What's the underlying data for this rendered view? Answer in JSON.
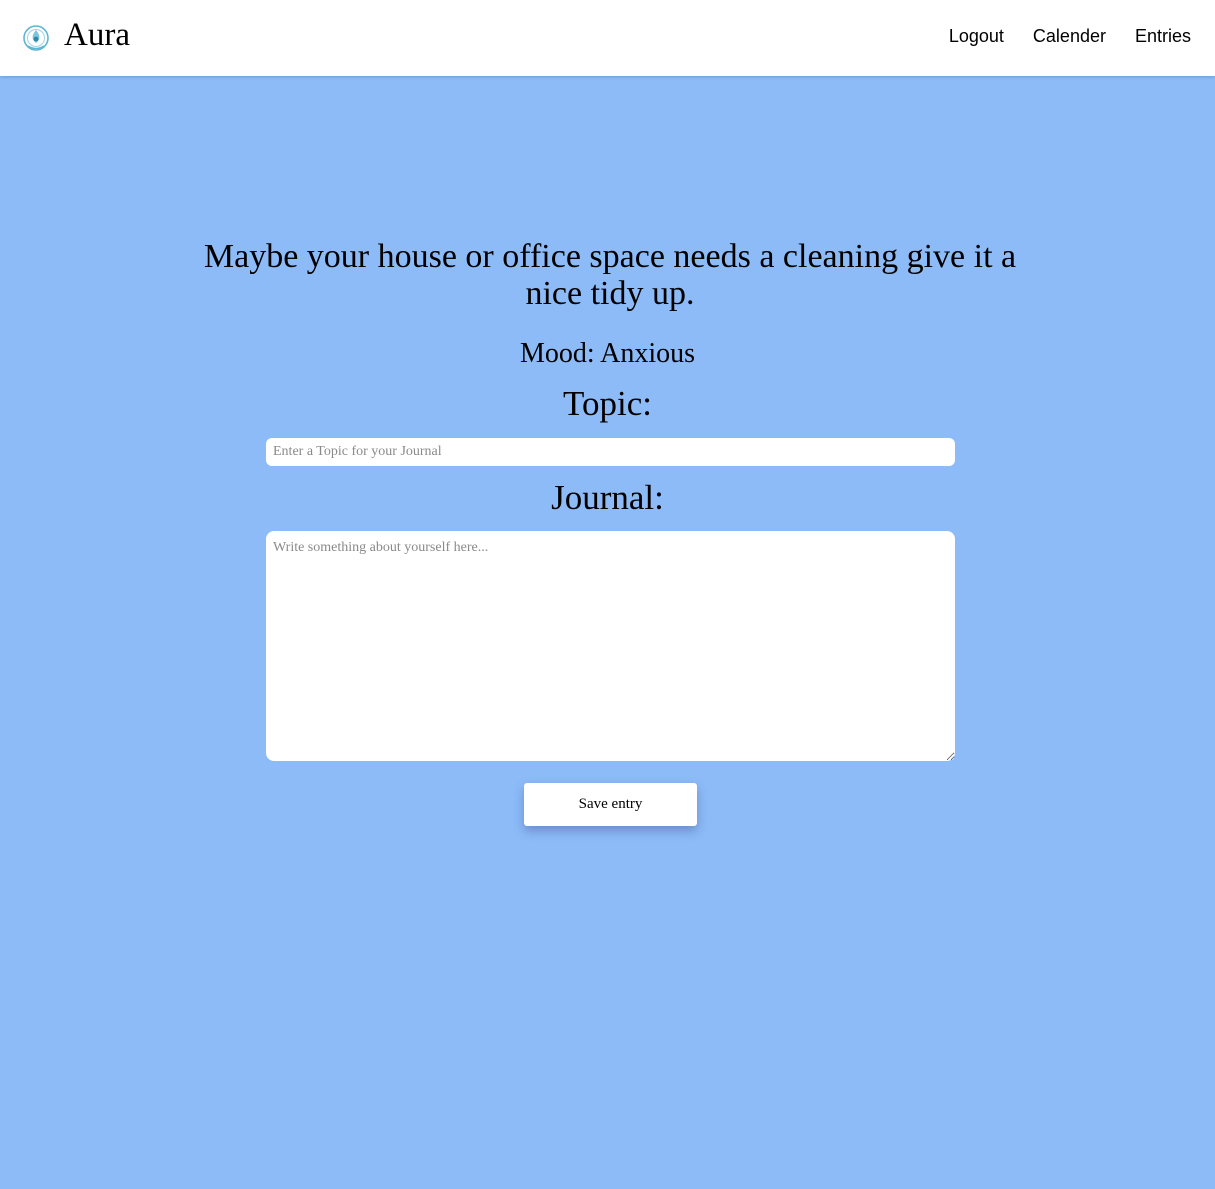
{
  "app": {
    "name": "Aura",
    "logo_icon": "aura-logo-icon",
    "accent": "#4aa8c9"
  },
  "nav": {
    "items": [
      {
        "label": "Logout"
      },
      {
        "label": "Calender"
      },
      {
        "label": "Entries"
      }
    ]
  },
  "main": {
    "prompt": "Maybe your house or office space needs a cleaning give it a nice tidy up.",
    "mood": "Mood: Anxious",
    "topic_label": "Topic:",
    "topic_placeholder": "Enter a Topic for your Journal",
    "topic_value": "",
    "journal_label": "Journal:",
    "journal_placeholder": "Write something about yourself here...",
    "journal_value": "",
    "save_label": "Save entry"
  },
  "colors": {
    "background": "#8cbbf8",
    "navbar": "#ffffff"
  }
}
